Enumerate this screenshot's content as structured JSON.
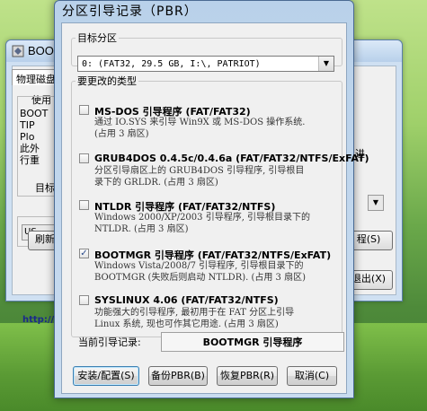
{
  "background_window": {
    "title": "BOOTICE",
    "tab": "物理磁盘",
    "group_label": "使用",
    "text_lines": [
      "BOOT",
      "TIP",
      "Plo",
      "此外",
      "行重"
    ],
    "right_text": "进",
    "target_label": "目标",
    "target_select_text": "US",
    "refresh_button": "刷新",
    "right_button_1": "程(S)",
    "right_button_2": "退出(X)",
    "url": "http://w"
  },
  "dialog": {
    "title": "分区引导记录（PBR）",
    "target_group": "目标分区",
    "target_value": "0: (FAT32,  29.5 GB, I:\\, PATRIOT)",
    "types_group": "要更改的类型",
    "options": [
      {
        "title": "MS-DOS 引导程序 (FAT/FAT32)",
        "checked": false,
        "desc": [
          "通过 IO.SYS 来引导 Win9X 或 MS-DOS 操作系统.",
          "(占用 3 扇区)"
        ]
      },
      {
        "title": "GRUB4DOS 0.4.5c/0.4.6a (FAT/FAT32/NTFS/ExFAT)",
        "checked": false,
        "desc": [
          "分区引导扇区上的 GRUB4DOS 引导程序, 引导根目",
          "录下的 GRLDR. (占用 3 扇区)"
        ]
      },
      {
        "title": "NTLDR 引导程序 (FAT/FAT32/NTFS)",
        "checked": false,
        "desc": [
          "Windows 2000/XP/2003 引导程序, 引导根目录下的",
          "NTLDR. (占用 3 扇区)"
        ]
      },
      {
        "title": "BOOTMGR 引导程序 (FAT/FAT32/NTFS/ExFAT)",
        "checked": true,
        "desc": [
          "Windows Vista/2008/7 引导程序, 引导根目录下的",
          "BOOTMGR (失败后则启动 NTLDR). (占用 3 扇区)"
        ]
      },
      {
        "title": "SYSLINUX 4.06 (FAT/FAT32/NTFS)",
        "checked": false,
        "desc": [
          "功能强大的引导程序, 最初用于在 FAT 分区上引导",
          "Linux 系统, 现也可作其它用途. (占用 3 扇区)"
        ]
      }
    ],
    "current_label": "当前引导记录:",
    "current_value": "BOOTMGR 引导程序",
    "buttons": {
      "install": "安装/配置(S)",
      "backup": "备份PBR(B)",
      "restore": "恢复PBR(R)",
      "cancel": "取消(C)"
    }
  }
}
